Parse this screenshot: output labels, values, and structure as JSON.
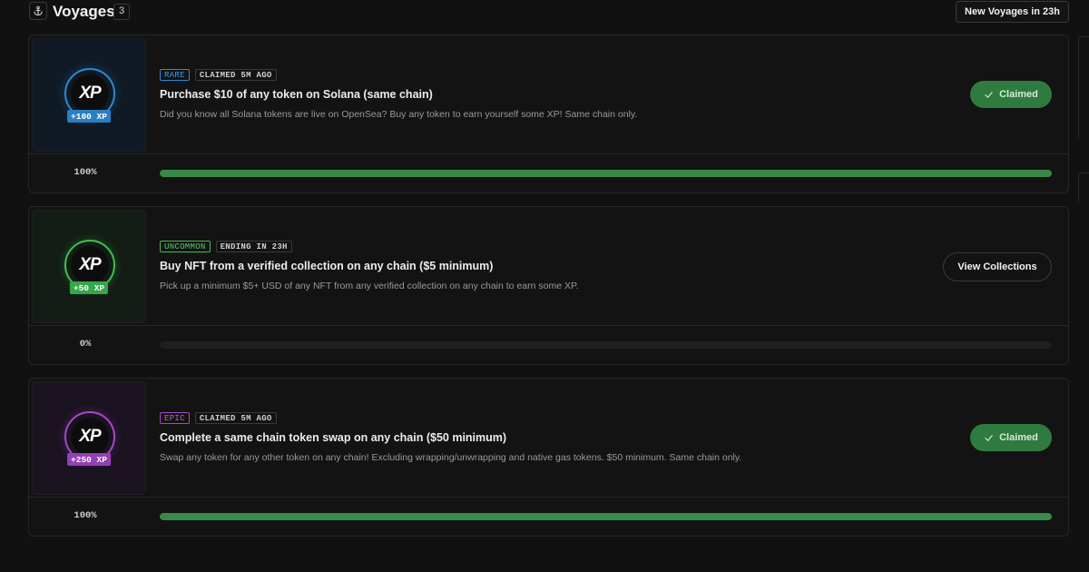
{
  "header": {
    "icon": "anchor-icon",
    "title": "Voyages",
    "count": "3",
    "new_voyages_label": "New Voyages in 23h"
  },
  "voyages": [
    {
      "rarity": "RARE",
      "status": "CLAIMED 5M AGO",
      "title": "Purchase $10 of any token on Solana (same chain)",
      "description": "Did you know all Solana tokens are live on OpenSea? Buy any token to earn yourself some XP! Same chain only.",
      "xp_mark": "XP",
      "xp_reward": "+100 XP",
      "action_label": "Claimed",
      "action_type": "claimed",
      "progress_label": "100%",
      "progress": 1.0,
      "accent": "#2a8bd6",
      "thumb_bg": "#101a24"
    },
    {
      "rarity": "UNCOMMON",
      "status": "ENDING IN 23H",
      "title": "Buy NFT from a verified collection on any chain ($5 minimum)",
      "description": "Pick up a minimum $5+ USD of any NFT from any verified collection on any chain to earn some XP.",
      "xp_mark": "XP",
      "xp_reward": "+50 XP",
      "action_label": "View Collections",
      "action_type": "link",
      "progress_label": "0%",
      "progress": 0.0,
      "accent": "#3fbf55",
      "thumb_bg": "#131d15"
    },
    {
      "rarity": "EPIC",
      "status": "CLAIMED 5M AGO",
      "title": "Complete a same chain token swap on any chain ($50 minimum)",
      "description": "Swap any token for any other token on any chain! Excluding wrapping/unwrapping and native gas tokens. $50 minimum. Same chain only.",
      "xp_mark": "XP",
      "xp_reward": "+250 XP",
      "action_label": "Claimed",
      "action_type": "claimed",
      "progress_label": "100%",
      "progress": 1.0,
      "accent": "#a449c9",
      "thumb_bg": "#1b1320"
    }
  ],
  "colors": {
    "background": "#111111",
    "progress_fill": "#3a8a47",
    "claimed_button": "#2f7a3e"
  }
}
